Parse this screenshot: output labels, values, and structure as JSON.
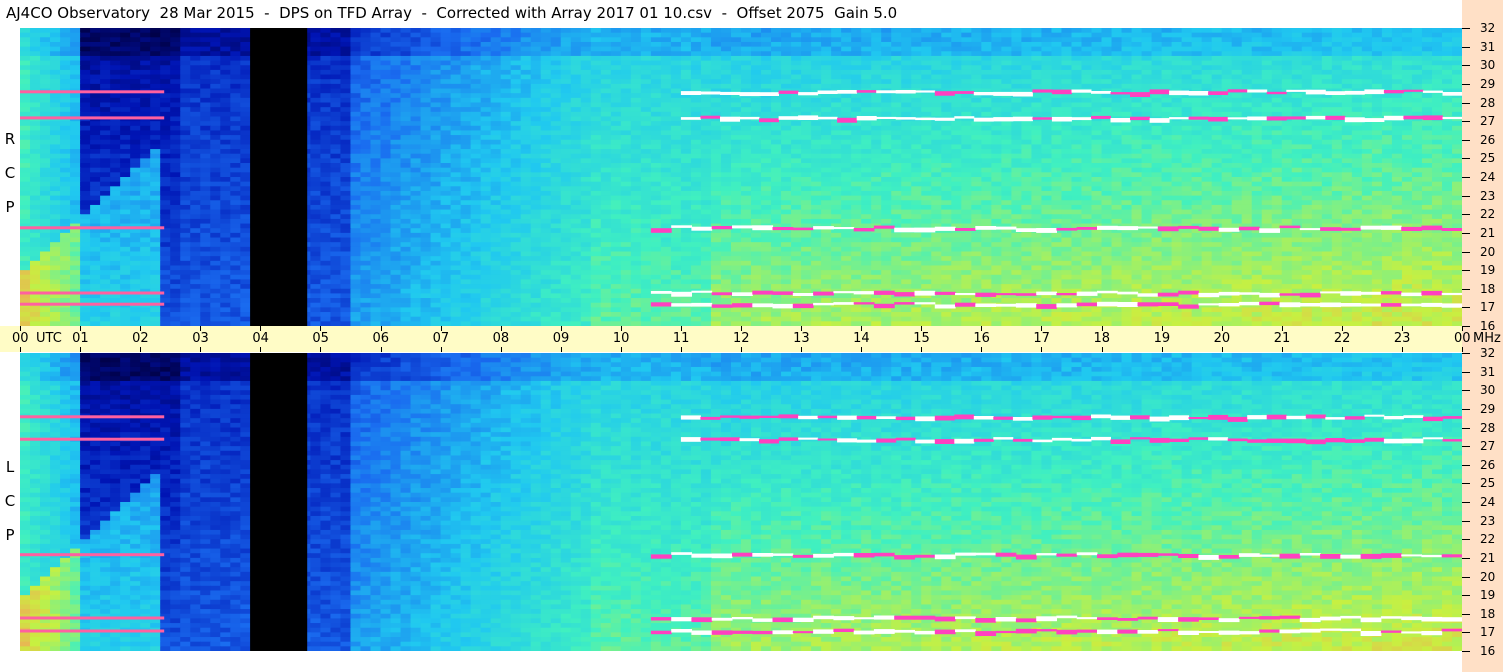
{
  "title": "AJ4CO Observatory  28 Mar 2015  -  DPS on TFD Array  -  Corrected with Array 2017 01 10.csv  -  Offset 2075  Gain 5.0",
  "colors": {
    "background": "#ffffff",
    "time_axis": "#fffcc6",
    "freq_axis": "#ffe0c6",
    "blanked": "#000000"
  },
  "chart_data": [
    {
      "type": "heatmap",
      "name": "RCP",
      "panel_label": [
        "R",
        "C",
        "P"
      ],
      "x_ticks": [
        "00",
        "01",
        "02",
        "03",
        "04",
        "05",
        "06",
        "07",
        "08",
        "09",
        "10",
        "11",
        "12",
        "13",
        "14",
        "15",
        "16",
        "17",
        "18",
        "19",
        "20",
        "21",
        "22",
        "23",
        "00"
      ],
      "xlabel": "UTC",
      "xlim": [
        0,
        24
      ],
      "y_ticks": [
        16,
        17,
        18,
        19,
        20,
        21,
        22,
        23,
        24,
        25,
        26,
        27,
        28,
        29,
        30,
        31,
        32
      ],
      "ylabel": "MHz",
      "ylim": [
        16,
        32
      ],
      "blanked_interval_utc": [
        3.83,
        4.78
      ],
      "strong_bands_mhz": [
        27.2,
        28.6,
        21.3,
        17.8,
        17.2
      ],
      "colormap": [
        "#000044",
        "#0014b4",
        "#1a6cf0",
        "#20c8f0",
        "#40f0c0",
        "#c8f040",
        "#ff9060",
        "#ff40c0",
        "#ffffff"
      ]
    },
    {
      "type": "heatmap",
      "name": "LCP",
      "panel_label": [
        "L",
        "C",
        "P"
      ],
      "x_ticks": [
        "00",
        "01",
        "02",
        "03",
        "04",
        "05",
        "06",
        "07",
        "08",
        "09",
        "10",
        "11",
        "12",
        "13",
        "14",
        "15",
        "16",
        "17",
        "18",
        "19",
        "20",
        "21",
        "22",
        "23",
        "00"
      ],
      "xlabel": "UTC",
      "xlim": [
        0,
        24
      ],
      "y_ticks": [
        16,
        17,
        18,
        19,
        20,
        21,
        22,
        23,
        24,
        25,
        26,
        27,
        28,
        29,
        30,
        31,
        32
      ],
      "ylabel": "MHz",
      "ylim": [
        16,
        32
      ],
      "blanked_interval_utc": [
        3.83,
        4.78
      ],
      "strong_bands_mhz": [
        27.4,
        28.6,
        21.2,
        17.8,
        17.1
      ],
      "colormap": [
        "#000044",
        "#0014b4",
        "#1a6cf0",
        "#20c8f0",
        "#40f0c0",
        "#c8f040",
        "#ff9060",
        "#ff40c0",
        "#ffffff"
      ]
    }
  ]
}
